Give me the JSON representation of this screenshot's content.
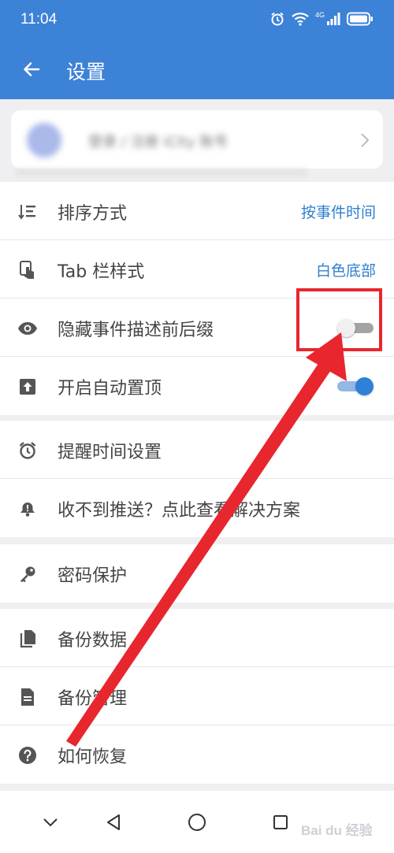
{
  "status_bar": {
    "time": "11:04",
    "network_label": "4G"
  },
  "header": {
    "title": "设置"
  },
  "account": {
    "name": "登录 / 注册 iCity 账号"
  },
  "groups": [
    {
      "items": [
        {
          "label": "排序方式",
          "value": "按事件时间",
          "icon": "sort-icon"
        },
        {
          "label": "Tab 栏样式",
          "value": "白色底部",
          "icon": "tap-icon"
        },
        {
          "label": "隐藏事件描述前后缀",
          "toggle": false,
          "icon": "eye-icon"
        },
        {
          "label": "开启自动置顶",
          "toggle": true,
          "icon": "upload-top-icon"
        }
      ]
    },
    {
      "items": [
        {
          "label": "提醒时间设置",
          "icon": "alarm-clock-icon"
        },
        {
          "label": "收不到推送？点此查看解决方案",
          "icon": "bell-alert-icon"
        }
      ]
    },
    {
      "items": [
        {
          "label": "密码保护",
          "icon": "key-icon"
        }
      ]
    },
    {
      "items": [
        {
          "label": "备份数据",
          "icon": "copy-icon"
        },
        {
          "label": "备份管理",
          "icon": "document-icon"
        },
        {
          "label": "如何恢复",
          "icon": "help-icon"
        }
      ]
    }
  ],
  "watermark": {
    "text": "Bai du 经验"
  },
  "colors": {
    "primary": "#3c82d7",
    "accent": "#2f80d8",
    "highlight": "#e8262e"
  }
}
